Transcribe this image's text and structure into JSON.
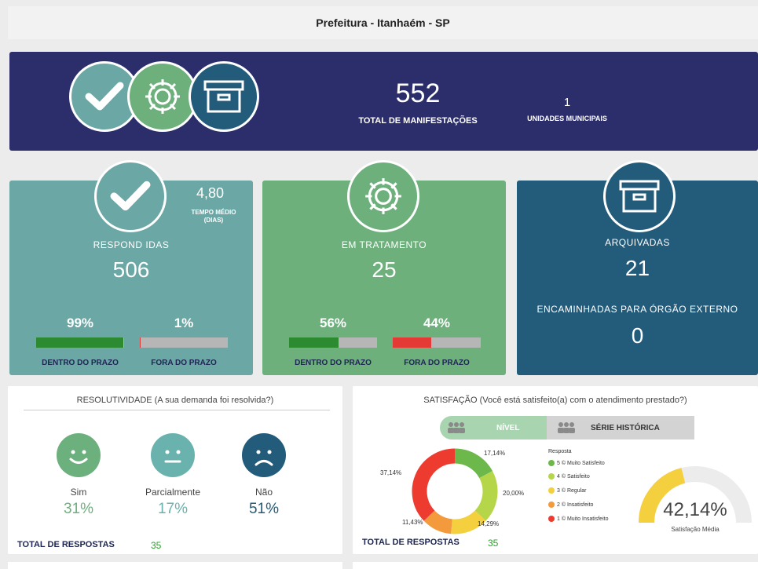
{
  "header": {
    "title": "Prefeitura - Itanhaém - SP"
  },
  "banner": {
    "total_value": "552",
    "total_label": "TOTAL DE MANIFESTAÇÕES",
    "units_value": "1",
    "units_label": "UNIDADES MUNICIPAIS"
  },
  "cards": {
    "respondidas": {
      "label": "RESPOND IDAS",
      "value": "506",
      "avg_value": "4,80",
      "avg_label_1": "TEMPO MÉDIO",
      "avg_label_2": "(DIAS)",
      "in_time_pct": "99%",
      "out_time_pct": "1%",
      "in_time_fraction": 0.99,
      "out_time_fraction": 0.01,
      "in_time_label": "DENTRO DO PRAZO",
      "out_time_label": "FORA DO PRAZO"
    },
    "tratamento": {
      "label": "EM TRATAMENTO",
      "value": "25",
      "in_time_pct": "56%",
      "out_time_pct": "44%",
      "in_time_fraction": 0.56,
      "out_time_fraction": 0.44,
      "in_time_label": "DENTRO DO PRAZO",
      "out_time_label": "FORA DO PRAZO"
    },
    "arquivadas": {
      "label": "ARQUIVADAS",
      "value": "21",
      "external_label": "ENCAMINHADAS PARA ÓRGÃO EXTERNO",
      "external_value": "0"
    }
  },
  "resolutividade": {
    "title": "RESOLUTIVIDADE (A sua demanda foi resolvida?)",
    "options": [
      {
        "label": "Sim",
        "pct": "31%",
        "color": "#6cb07e"
      },
      {
        "label": "Parcialmente",
        "pct": "17%",
        "color": "#6ab2ae"
      },
      {
        "label": "Não",
        "pct": "51%",
        "color": "#235b7b"
      }
    ],
    "total_label": "TOTAL DE RESPOSTAS",
    "total_value": "35"
  },
  "satisfacao": {
    "title": "SATISFAÇÃO (Você está satisfeito(a) com o atendimento prestado?)",
    "tab_level": "NÍVEL",
    "tab_history": "SÉRIE HISTÓRICA",
    "legend_title": "Resposta",
    "legend": [
      {
        "label": "5 © Muito Satisfeito",
        "color": "#6cb84b",
        "value": 17.14
      },
      {
        "label": "4 © Satisfeito",
        "color": "#b6d64a",
        "value": 20.0
      },
      {
        "label": "3 © Regular",
        "color": "#f4d03f",
        "value": 14.29
      },
      {
        "label": "2 © Insatisfeito",
        "color": "#f39a3c",
        "value": 11.43
      },
      {
        "label": "1 © Muito Insatisfeito",
        "color": "#ee3b2f",
        "value": 37.14
      }
    ],
    "donut_labels": [
      "17,14%",
      "20,00%",
      "14,29%",
      "11,43%",
      "37,14%"
    ],
    "gauge_value": "42,14%",
    "gauge_fraction": 0.4214,
    "gauge_label": "Satisfação Média",
    "total_label": "TOTAL DE RESPOSTAS",
    "total_value": "35"
  }
}
